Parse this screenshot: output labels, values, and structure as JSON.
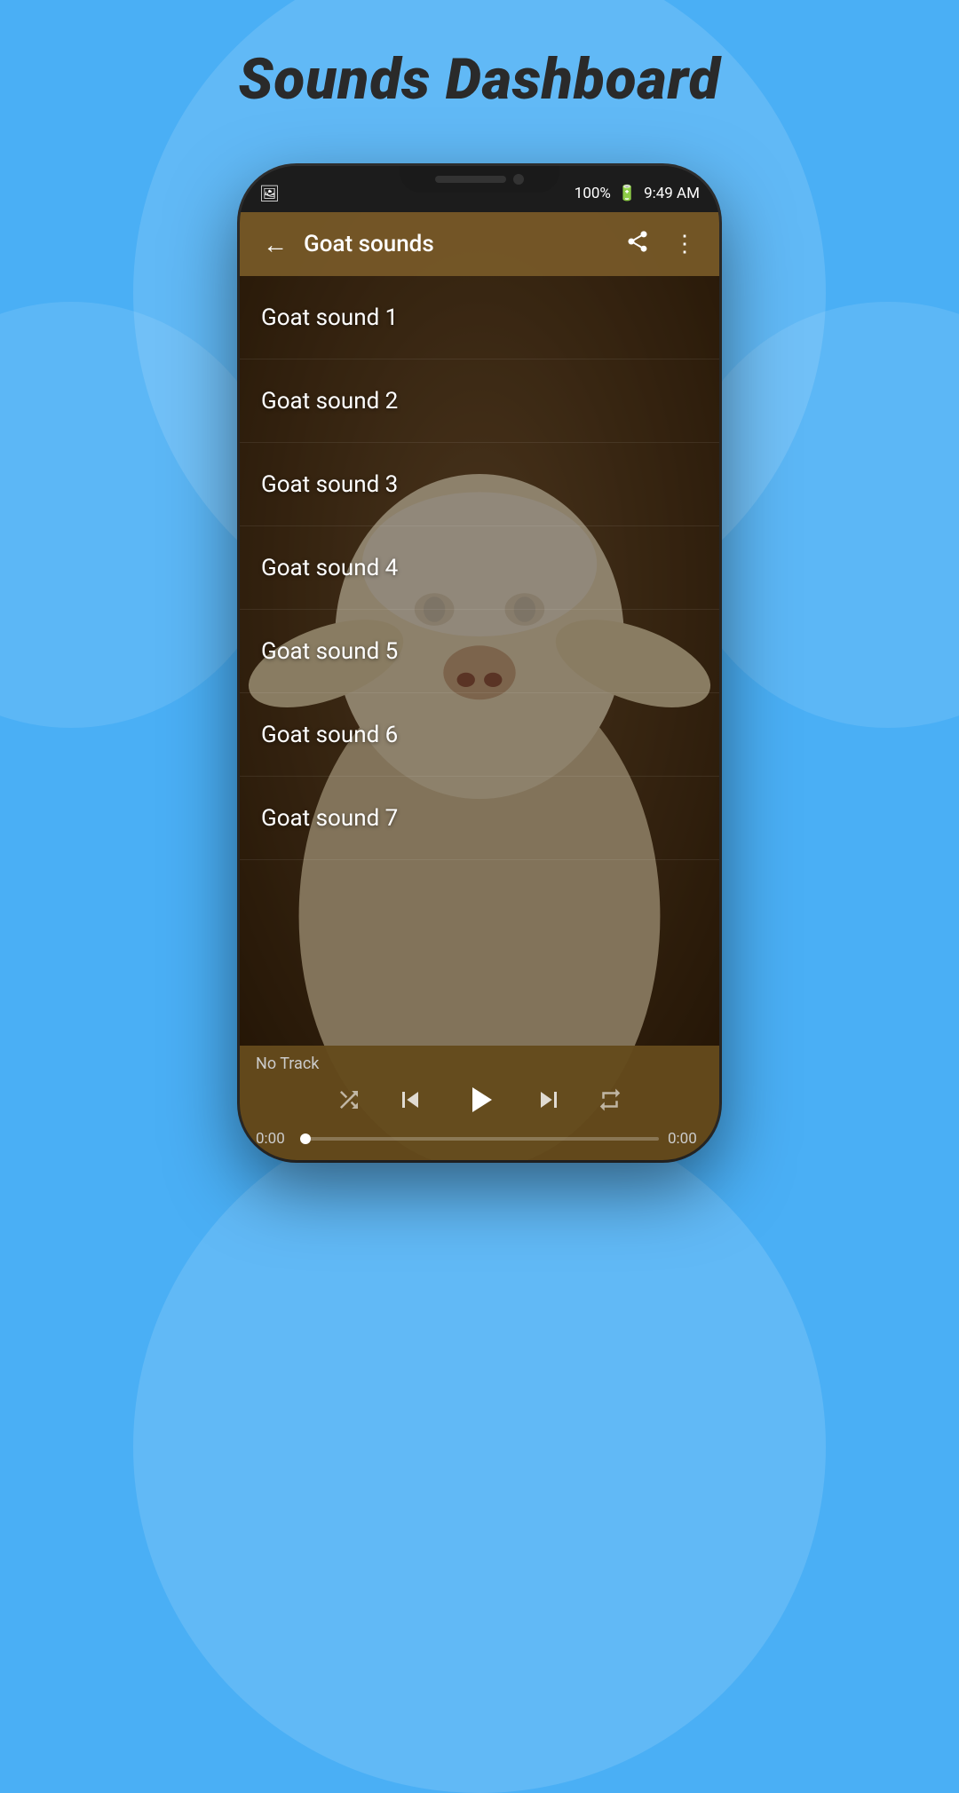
{
  "page": {
    "title": "Sounds Dashboard",
    "background_color": "#4aaff5"
  },
  "app": {
    "app_bar": {
      "title": "Goat sounds",
      "back_icon": "←",
      "share_icon": "share",
      "more_icon": "⋮"
    },
    "status_bar": {
      "time": "9:49 AM",
      "battery": "100%"
    },
    "sounds": [
      {
        "id": 1,
        "label": "Goat sound 1"
      },
      {
        "id": 2,
        "label": "Goat sound 2"
      },
      {
        "id": 3,
        "label": "Goat sound 3"
      },
      {
        "id": 4,
        "label": "Goat sound 4"
      },
      {
        "id": 5,
        "label": "Goat sound 5"
      },
      {
        "id": 6,
        "label": "Goat sound 6"
      },
      {
        "id": 7,
        "label": "Goat sound 7"
      }
    ],
    "player": {
      "track_name": "No Track",
      "time_current": "0:00",
      "time_total": "0:00",
      "shuffle_icon": "⇌",
      "prev_icon": "⏮",
      "play_icon": "▶",
      "next_icon": "⏭",
      "repeat_icon": "↺"
    }
  }
}
